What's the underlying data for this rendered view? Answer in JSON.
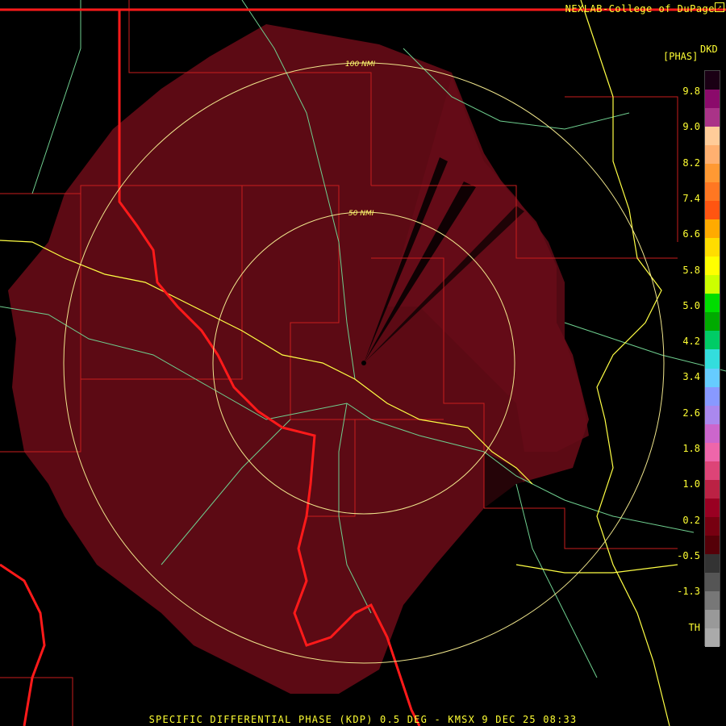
{
  "credit": "NEXLAB-College of DuPage",
  "legend": {
    "product_label": "DKD",
    "unit_label": "[PHAS]",
    "ticks": [
      "9.8",
      "9.0",
      "8.2",
      "7.4",
      "6.6",
      "5.8",
      "5.0",
      "4.2",
      "3.4",
      "2.6",
      "1.8",
      "1.0",
      "0.2",
      "-0.5",
      "-1.3",
      "TH"
    ],
    "colors": [
      "#1a0014",
      "#8b0a6b",
      "#aa3388",
      "#ffcc99",
      "#ffb070",
      "#ff9933",
      "#ff7722",
      "#ff5511",
      "#ffaa00",
      "#ffdd00",
      "#ffff00",
      "#ccff00",
      "#00dd00",
      "#00aa00",
      "#00cc66",
      "#33dddd",
      "#66ccff",
      "#8899ff",
      "#aa88ee",
      "#cc66cc",
      "#ee66aa",
      "#dd4477",
      "#bb2244",
      "#990022",
      "#770011",
      "#550008",
      "#333333",
      "#555555",
      "#777777",
      "#999999",
      "#aaaaaa"
    ]
  },
  "rings": [
    {
      "label": "50 NMI"
    },
    {
      "label": "100 NMI"
    }
  ],
  "footer": "SPECIFIC DIFFERENTIAL PHASE (KDP) 0.5 DEG - KMSX 9 DEC 25 08:33",
  "colors": {
    "background": "#000000",
    "echo": "#5c0a14",
    "state_border": "#ff1a1a",
    "county_border": "#c81e1e",
    "river": "#6fcf8f",
    "highway": "#ffff44",
    "text": "#ffff33"
  }
}
